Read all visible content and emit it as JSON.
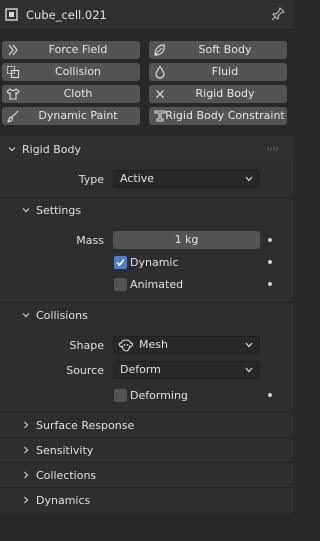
{
  "header": {
    "title": "Cube_cell.021",
    "object_icon": "cube-object-icon",
    "pin_icon": "pin-icon"
  },
  "physics_buttons": [
    {
      "label": "Force Field",
      "icon": "force-field-icon"
    },
    {
      "label": "Soft Body",
      "icon": "soft-body-icon"
    },
    {
      "label": "Collision",
      "icon": "collision-icon"
    },
    {
      "label": "Fluid",
      "icon": "fluid-icon"
    },
    {
      "label": "Cloth",
      "icon": "cloth-icon"
    },
    {
      "label": "Rigid Body",
      "icon": "rigid-body-remove-icon"
    },
    {
      "label": "Dynamic Paint",
      "icon": "dynamic-paint-icon"
    },
    {
      "label": "Rigid Body Constraint",
      "icon": "rigid-body-constraint-icon"
    }
  ],
  "rigid_body": {
    "title": "Rigid Body",
    "type_label": "Type",
    "type_value": "Active",
    "settings": {
      "title": "Settings",
      "mass_label": "Mass",
      "mass_value": "1 kg",
      "dynamic_label": "Dynamic",
      "dynamic_checked": true,
      "animated_label": "Animated",
      "animated_checked": false
    },
    "collisions": {
      "title": "Collisions",
      "shape_label": "Shape",
      "shape_value": "Mesh",
      "shape_icon": "mesh-monkey-icon",
      "source_label": "Source",
      "source_value": "Deform",
      "deforming_label": "Deforming",
      "deforming_checked": false
    },
    "collapsed_subpanels": [
      "Surface Response",
      "Sensitivity",
      "Collections",
      "Dynamics"
    ]
  },
  "colors": {
    "accent": "#4b7fc9",
    "button": "#545454",
    "panel": "#2e2e2e",
    "background": "#282828"
  }
}
